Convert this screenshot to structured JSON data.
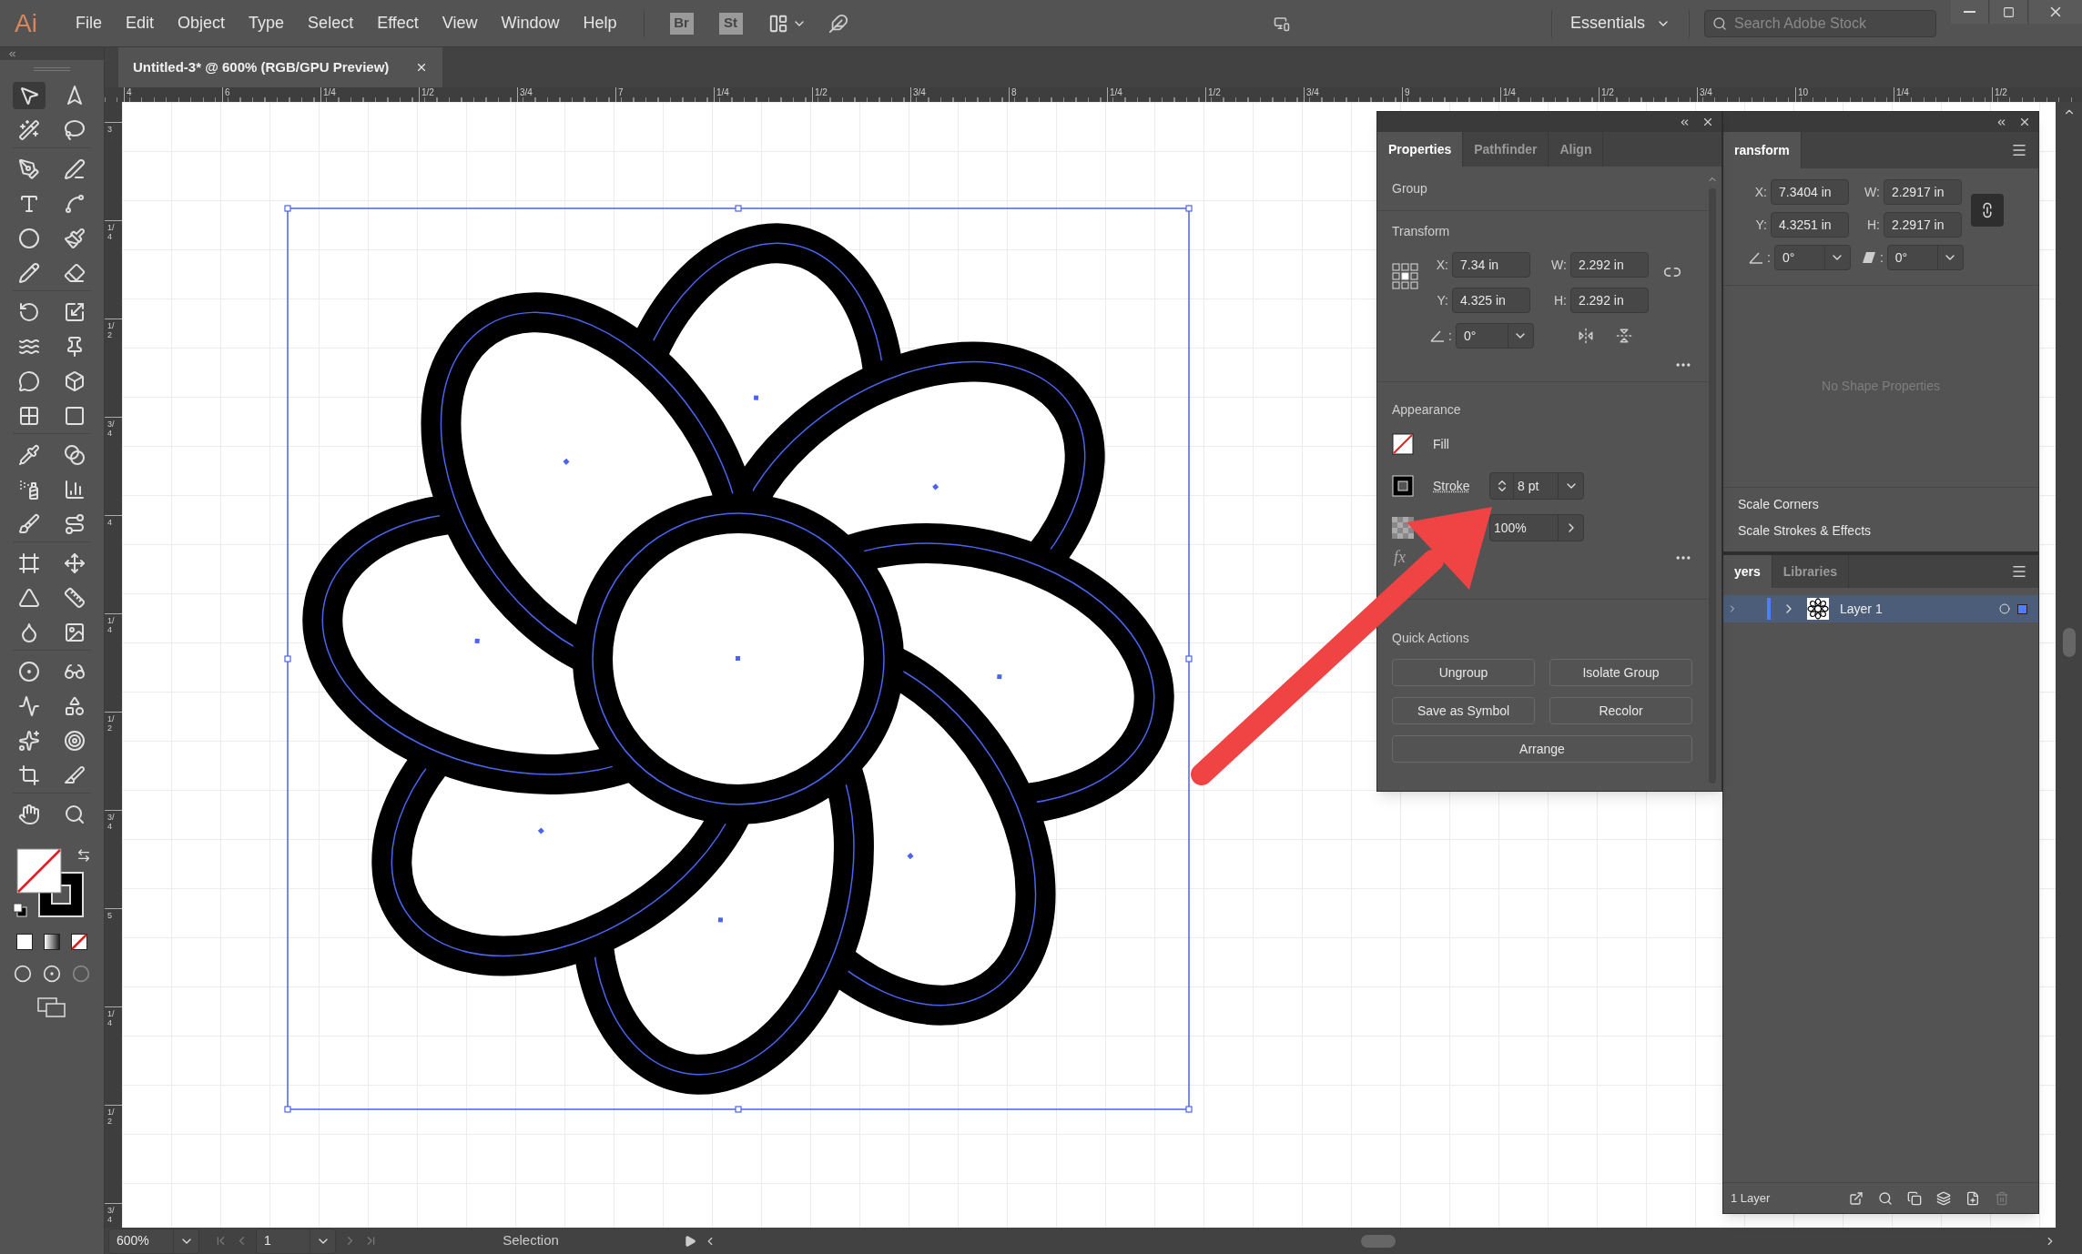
{
  "app": {
    "logo": "Ai",
    "menu": [
      "File",
      "Edit",
      "Object",
      "Type",
      "Select",
      "Effect",
      "View",
      "Window",
      "Help"
    ],
    "bridge": "Br",
    "stock": "St",
    "workspace": "Essentials",
    "search": {
      "placeholder": "Search Adobe Stock"
    }
  },
  "document_tab": {
    "title": "Untitled-3* @ 600% (RGB/GPU Preview)"
  },
  "ruler": {
    "horizontal": [
      "4",
      "6",
      "1/4",
      "1/2",
      "3/4",
      "7",
      "1/4",
      "1/2",
      "3/4",
      "8",
      "1/4",
      "1/2",
      "3/4",
      "9",
      "1/4",
      "1/2",
      "3/4",
      "10",
      "1/4",
      "1/2"
    ],
    "vertical": [
      "3",
      "1/4",
      "1/2",
      "3/4",
      "4",
      "1/4",
      "1/2",
      "3/4",
      "5",
      "1/4",
      "1/2",
      "3/4"
    ]
  },
  "properties_panel": {
    "tabs": [
      {
        "label": "Properties",
        "selected": true
      },
      {
        "label": "Pathfinder",
        "selected": false
      },
      {
        "label": "Align",
        "selected": false
      }
    ],
    "selection_type": "Group",
    "transform": {
      "heading": "Transform",
      "fields": [
        {
          "label": "X:",
          "value": "7.34 in"
        },
        {
          "label": "W:",
          "value": "2.292 in"
        },
        {
          "label": "Y:",
          "value": "4.325 in"
        },
        {
          "label": "H:",
          "value": "2.292 in"
        }
      ],
      "angle": {
        "label": ":",
        "value": "0°"
      }
    },
    "appearance": {
      "heading": "Appearance",
      "rows": [
        {
          "kind": "fill",
          "label": "Fill"
        },
        {
          "kind": "stroke",
          "label": "Stroke",
          "value": "8 pt"
        },
        {
          "kind": "opacity",
          "value": "100%"
        }
      ],
      "fx": "fx"
    },
    "quick_actions": {
      "heading": "Quick Actions",
      "buttons": [
        "Ungroup",
        "Isolate Group",
        "Save as Symbol",
        "Recolor"
      ],
      "wide_button": "Arrange"
    }
  },
  "transform_panel": {
    "tab": {
      "label": "ransform",
      "selected": true
    },
    "fields": [
      {
        "label": "X:",
        "value": "7.3404 in"
      },
      {
        "label": "W:",
        "value": "2.2917 in"
      },
      {
        "label": "Y:",
        "value": "4.3251 in"
      },
      {
        "label": "H:",
        "value": "2.2917 in"
      }
    ],
    "rotate": {
      "label": ":",
      "value": "0°"
    },
    "shear": {
      "label": ":",
      "value": "0°"
    },
    "empty_message": "No Shape Properties",
    "options": [
      "Scale Corners",
      "Scale Strokes & Effects"
    ]
  },
  "layers_panel": {
    "tabs": [
      {
        "label": "yers",
        "selected": true
      },
      {
        "label": "Libraries",
        "selected": false
      }
    ],
    "layers": [
      {
        "name": "Layer 1",
        "selected": true,
        "color": "#4f7dff"
      }
    ],
    "footer": "1 Layer"
  },
  "status_bar": {
    "zoom": "600%",
    "artboard": "1",
    "tool": "Selection"
  }
}
